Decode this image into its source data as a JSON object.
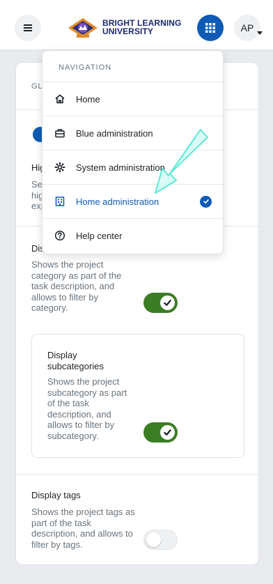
{
  "header": {
    "brand_line1": "BRIGHT LEARNING",
    "brand_line2": "UNIVERSITY",
    "avatar_initials": "AP",
    "icons": {
      "menu": "hamburger-icon",
      "apps": "grid-icon",
      "avatar_caret": "caret-down-icon"
    }
  },
  "card": {
    "heading_partial": "GL",
    "setting_partial_title": "Hig",
    "setting_partial_desc_1": "Set",
    "setting_partial_desc_2": "hig",
    "setting_partial_desc_3": "exp",
    "category_title_partial": "Dis",
    "category_desc": "Shows the project category as part of the task description, and allows to filter by category.",
    "category_enabled": true,
    "subcategories": {
      "title": "Display subcategories",
      "desc": "Shows the project subcategory as part of the task description, and allows to filter by subcategory.",
      "enabled": true
    },
    "tags": {
      "title": "Display tags",
      "desc": "Shows the project tags as part of the task description, and allows to filter by tags.",
      "enabled": false
    }
  },
  "dropdown": {
    "heading": "NAVIGATION",
    "items": [
      {
        "label": "Home",
        "icon": "home-icon",
        "active": false
      },
      {
        "label": "Blue administration",
        "icon": "briefcase-icon",
        "active": false
      },
      {
        "label": "System administration",
        "icon": "gear-icon",
        "active": false
      },
      {
        "label": "Home administration",
        "icon": "building-icon",
        "active": true
      },
      {
        "label": "Help center",
        "icon": "help-circle-icon",
        "active": false
      }
    ]
  },
  "colors": {
    "primary": "#0f5bb5",
    "toggle_on": "#3b7d23",
    "arrow": "#5ee8d6",
    "brand": "#1b2a6b"
  }
}
